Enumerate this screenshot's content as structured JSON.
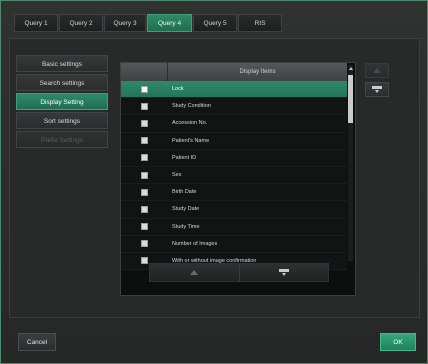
{
  "tabs": [
    {
      "label": "Query 1",
      "active": false
    },
    {
      "label": "Query 2",
      "active": false
    },
    {
      "label": "Query 3",
      "active": false
    },
    {
      "label": "Query 4",
      "active": true
    },
    {
      "label": "Query 5",
      "active": false
    },
    {
      "label": "RIS",
      "active": false
    }
  ],
  "nav": [
    {
      "label": "Basic settings",
      "state": "normal"
    },
    {
      "label": "Search settings",
      "state": "normal"
    },
    {
      "label": "Display Setting",
      "state": "active"
    },
    {
      "label": "Sort settings",
      "state": "normal"
    },
    {
      "label": "Prefix Settings",
      "state": "disabled"
    }
  ],
  "list": {
    "header_label": "Display Items",
    "items": [
      {
        "label": "Lock",
        "checked": true,
        "selected": true
      },
      {
        "label": "Study Condition",
        "checked": true,
        "selected": false
      },
      {
        "label": "Accession No.",
        "checked": true,
        "selected": false
      },
      {
        "label": "Patient's Name",
        "checked": true,
        "selected": false
      },
      {
        "label": "Patient ID",
        "checked": true,
        "selected": false
      },
      {
        "label": "Sex",
        "checked": true,
        "selected": false
      },
      {
        "label": "Birth Date",
        "checked": true,
        "selected": false
      },
      {
        "label": "Study Date",
        "checked": true,
        "selected": false
      },
      {
        "label": "Study Time",
        "checked": true,
        "selected": false
      },
      {
        "label": "Number of Images",
        "checked": true,
        "selected": false
      },
      {
        "label": "With or without image confirmation",
        "checked": true,
        "selected": false
      }
    ]
  },
  "footer": {
    "cancel_label": "Cancel",
    "ok_label": "OK"
  },
  "colors": {
    "accent": "#2f8a68",
    "ok": "#33a87a"
  },
  "icons": {
    "move_up": "triangle-up-icon",
    "move_down": "card-down-icon"
  }
}
